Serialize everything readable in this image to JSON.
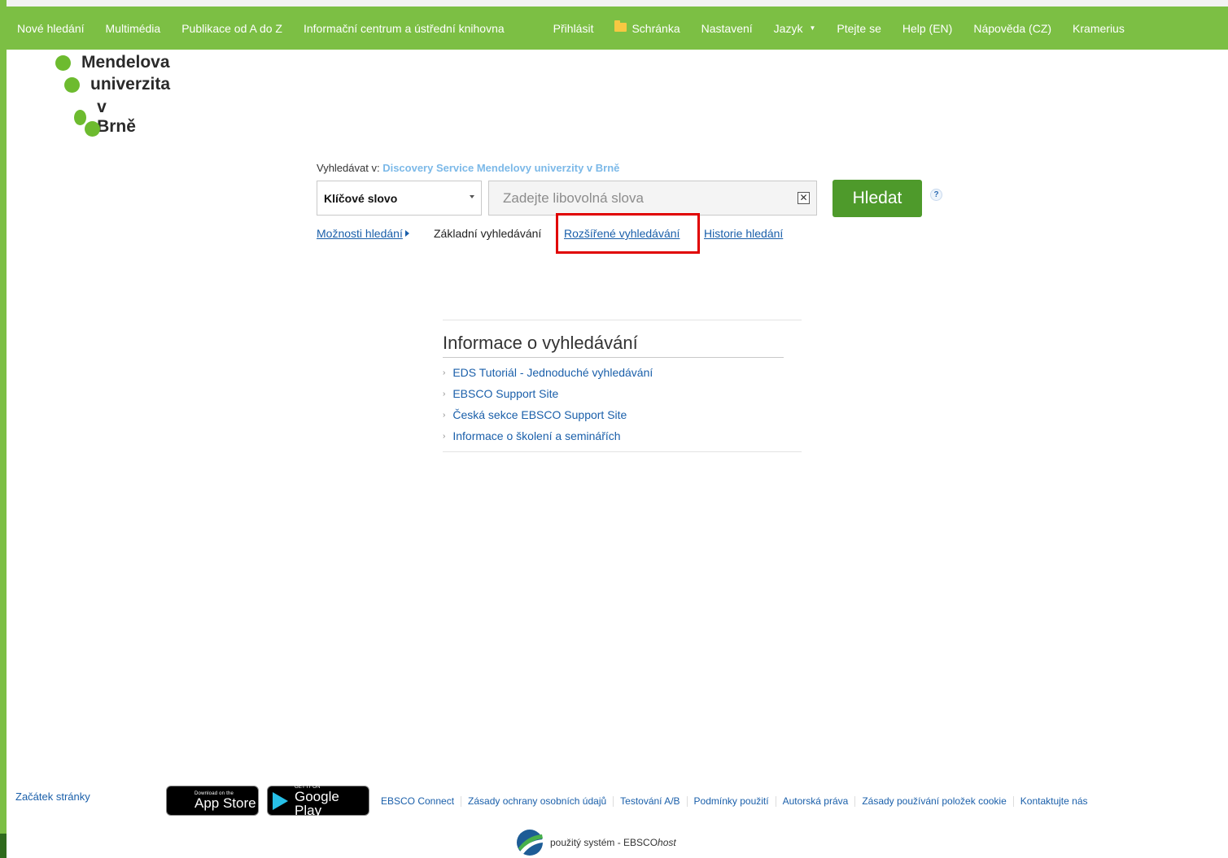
{
  "nav": {
    "left_items": [
      "Nové hledání",
      "Multimédia",
      "Publikace od A do Z",
      "Informační centrum a ústřední knihovna"
    ],
    "right": {
      "login": "Přihlásit",
      "folder": "Schránka",
      "settings": "Nastavení",
      "language": "Jazyk",
      "ask": "Ptejte se",
      "help_en": "Help (EN)",
      "help_cz": "Nápověda (CZ)",
      "kramerius": "Kramerius"
    }
  },
  "logo": {
    "line1": "Mendelova",
    "line2": "univerzita",
    "line3": "v Brně"
  },
  "search": {
    "label_prefix": "Vyhledávat v:",
    "database": "Discovery Service Mendelovy univerzity v Brně",
    "field_selected": "Klíčové slovo",
    "placeholder": "Zadejte libovolná slova",
    "button": "Hledat",
    "help_icon_char": "?",
    "clear_icon_char": "✕",
    "links": {
      "options": "Možnosti hledání",
      "basic": "Základní vyhledávání",
      "advanced": "Rozšířené vyhledávání",
      "history": "Historie hledání"
    }
  },
  "info": {
    "title": "Informace o vyhledávání",
    "items": [
      "EDS Tutoriál - Jednoduché vyhledávání",
      "EBSCO Support Site",
      "Česká sekce EBSCO Support Site",
      "Informace o školení a seminářích"
    ]
  },
  "footer": {
    "top_link": "Začátek stránky",
    "app_store": {
      "small": "Download on the",
      "big": "App Store"
    },
    "google_play": {
      "small": "GET IT ON",
      "big": "Google Play"
    },
    "links": [
      "EBSCO Connect",
      "Zásady ochrany osobních údajů",
      "Testování A/B",
      "Podmínky použití",
      "Autorská práva",
      "Zásady používání položek cookie",
      "Kontaktujte nás"
    ],
    "powered_prefix": "použitý systém - EBSCO",
    "powered_suffix": "host"
  },
  "colors": {
    "nav_green": "#7cbf44",
    "button_green": "#4e9a2b",
    "link_blue": "#1a5faa",
    "highlight_red": "#e00000",
    "database_blue": "#7cb9e8"
  }
}
